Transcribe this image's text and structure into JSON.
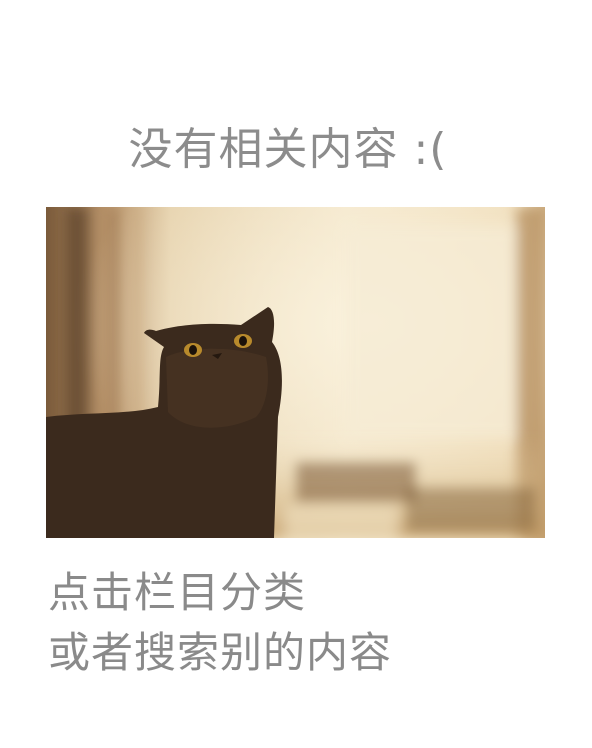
{
  "empty_state": {
    "title": "没有相关内容 :(",
    "hint_line_1": "点击栏目分类",
    "hint_line_2": "或者搜索别的内容",
    "image": {
      "subject": "cat-photo",
      "colors": {
        "background_light": "#f4e7cb",
        "background_warm": "#d9b985",
        "cat_dark": "#3a2a1e",
        "eye": "#c89a3a"
      }
    }
  }
}
